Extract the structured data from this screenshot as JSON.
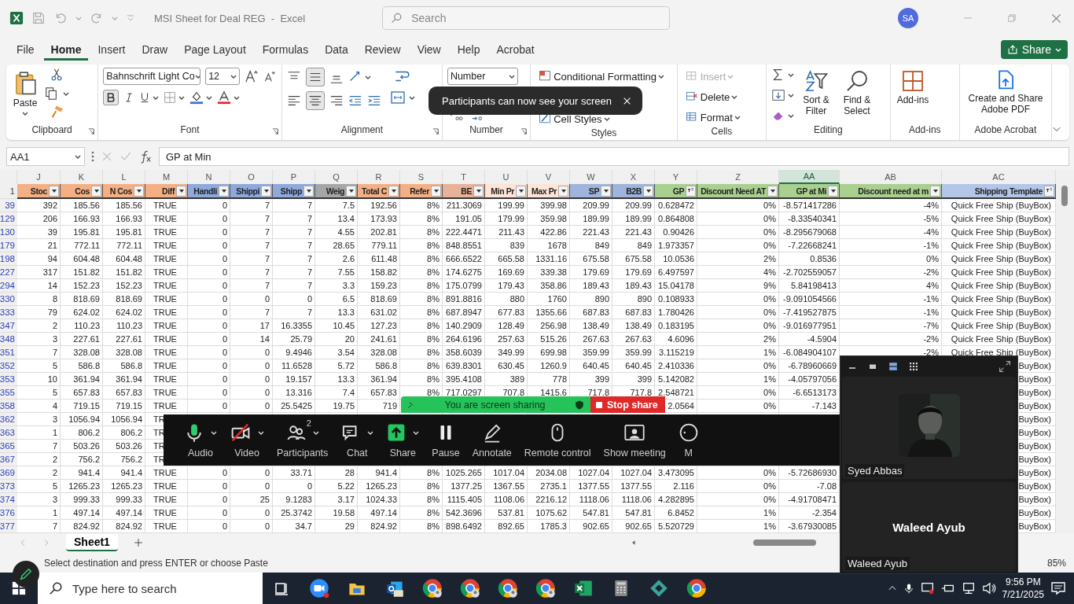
{
  "title_bar": {
    "title": "MSI Sheet for Deal REG  -  Excel",
    "search": {
      "placeholder": "Search"
    },
    "avatar": "SA"
  },
  "menu_tabs": [
    {
      "label": "File",
      "selected": false
    },
    {
      "label": "Home",
      "selected": true
    },
    {
      "label": "Insert",
      "selected": false
    },
    {
      "label": "Draw",
      "selected": false
    },
    {
      "label": "Page Layout",
      "selected": false
    },
    {
      "label": "Formulas",
      "selected": false
    },
    {
      "label": "Data",
      "selected": false
    },
    {
      "label": "Review",
      "selected": false
    },
    {
      "label": "View",
      "selected": false
    },
    {
      "label": "Help",
      "selected": false
    },
    {
      "label": "Acrobat",
      "selected": false
    }
  ],
  "share_button": "Share",
  "clipboard": {
    "label": "Clipboard",
    "paste": "Paste"
  },
  "font": {
    "label": "Font",
    "name": "Bahnschrift Light Co",
    "size": "12",
    "bold": true
  },
  "alignment": {
    "label": "Alignment",
    "middle_selected": true,
    "center_selected": true
  },
  "number": {
    "label": "Number",
    "format": "Number"
  },
  "styles": {
    "label": "Styles",
    "items": [
      "Conditional Formatting",
      "Cell Styles"
    ]
  },
  "cells": {
    "label": "Cells",
    "items": [
      {
        "kind": "insert",
        "label": "Insert",
        "disabled": true
      },
      {
        "kind": "delete",
        "label": "Delete",
        "disabled": false
      },
      {
        "kind": "format",
        "label": "Format",
        "disabled": false
      }
    ]
  },
  "editing": {
    "label": "Editing",
    "sort": "Sort & Filter",
    "find": "Find & Select"
  },
  "addins": {
    "label": "Add-ins",
    "button": "Add-ins"
  },
  "acrobat": {
    "label": "Adobe Acrobat",
    "button": "Create and Share Adobe PDF"
  },
  "toast": {
    "text": "Participants can now see your screen"
  },
  "formula_bar": {
    "name_box": "AA1",
    "formula": "GP at Min"
  },
  "sheet": {
    "header_row": "1",
    "columns": [
      {
        "letter": "J",
        "header": "Stoc",
        "color": "#f4b084",
        "kind": "number",
        "filtered": false,
        "selected": false
      },
      {
        "letter": "K",
        "header": "Cos",
        "color": "#f4b084",
        "kind": "number",
        "filtered": false,
        "selected": false
      },
      {
        "letter": "L",
        "header": "N Cos",
        "color": "#f4b084",
        "kind": "number",
        "filtered": false,
        "selected": false
      },
      {
        "letter": "M",
        "header": "Diff",
        "color": "#f4b084",
        "kind": "boolean",
        "filtered": false,
        "selected": false
      },
      {
        "letter": "N",
        "header": "Handli",
        "color": "#8ea9db",
        "kind": "number",
        "filtered": false,
        "selected": false
      },
      {
        "letter": "O",
        "header": "Shippi",
        "color": "#8ea9db",
        "kind": "number",
        "filtered": false,
        "selected": false
      },
      {
        "letter": "P",
        "header": "Shipp",
        "color": "#8ea9db",
        "kind": "number",
        "filtered": false,
        "selected": false
      },
      {
        "letter": "Q",
        "header": "Weig",
        "color": "#a6a6a6",
        "kind": "number",
        "filtered": false,
        "selected": false
      },
      {
        "letter": "R",
        "header": "Total C",
        "color": "#f4b084",
        "kind": "number",
        "filtered": false,
        "selected": false
      },
      {
        "letter": "S",
        "header": "Refer",
        "color": "#f4b084",
        "kind": "number",
        "filtered": false,
        "selected": false
      },
      {
        "letter": "T",
        "header": "BE",
        "color": "#e8b199",
        "kind": "number",
        "filtered": false,
        "selected": false
      },
      {
        "letter": "U",
        "header": "Min Pr",
        "color": "#fce4d6",
        "kind": "number",
        "filtered": false,
        "selected": false
      },
      {
        "letter": "V",
        "header": "Max Pr",
        "color": "#fce4d6",
        "kind": "number",
        "filtered": false,
        "selected": false
      },
      {
        "letter": "W",
        "header": "SP",
        "color": "#9fb4dc",
        "kind": "number",
        "filtered": false,
        "selected": false
      },
      {
        "letter": "X",
        "header": "B2B",
        "color": "#9fb4dc",
        "kind": "number",
        "filtered": false,
        "selected": false
      },
      {
        "letter": "Y",
        "header": "GP",
        "color": "#a9d08e",
        "kind": "number",
        "filtered": true,
        "selected": false
      },
      {
        "letter": "Z",
        "header": "Discount Need AT",
        "color": "#a9d08e",
        "kind": "number",
        "filtered": false,
        "selected": false
      },
      {
        "letter": "AA",
        "header": "GP at Mi",
        "color": "#a9d08e",
        "kind": "number",
        "filtered": false,
        "selected": true
      },
      {
        "letter": "AB",
        "header": "Discount need at m",
        "color": "#a9d08e",
        "kind": "number",
        "filtered": false,
        "selected": false
      },
      {
        "letter": "AC",
        "header": "Shipping Template",
        "color": "#b4c6e7",
        "kind": "text",
        "filtered": true,
        "selected": false
      }
    ],
    "rows": [
      {
        "number": "39",
        "cells": [
          "392",
          "185.56",
          "185.56",
          "TRUE",
          "0",
          "7",
          "7",
          "7.5",
          "192.56",
          "8%",
          "211.3069",
          "199.99",
          "399.98",
          "209.99",
          "209.99",
          "0.628472",
          "0%",
          "-8.571417286",
          "-4%",
          "Quick Free Ship (BuyBox)"
        ]
      },
      {
        "number": "129",
        "cells": [
          "206",
          "166.93",
          "166.93",
          "TRUE",
          "0",
          "7",
          "7",
          "13.4",
          "173.93",
          "8%",
          "191.05",
          "179.99",
          "359.98",
          "189.99",
          "189.99",
          "0.864808",
          "0%",
          "-8.33540341",
          "-5%",
          "Quick Free Ship (BuyBox)"
        ]
      },
      {
        "number": "130",
        "cells": [
          "39",
          "195.81",
          "195.81",
          "TRUE",
          "0",
          "7",
          "7",
          "4.55",
          "202.81",
          "8%",
          "222.4471",
          "211.43",
          "422.86",
          "221.43",
          "221.43",
          "0.90426",
          "0%",
          "-8.295679068",
          "-4%",
          "Quick Free Ship (BuyBox)"
        ]
      },
      {
        "number": "179",
        "cells": [
          "21",
          "772.11",
          "772.11",
          "TRUE",
          "0",
          "7",
          "7",
          "28.65",
          "779.11",
          "8%",
          "848.8551",
          "839",
          "1678",
          "849",
          "849",
          "1.973357",
          "0%",
          "-7.22668241",
          "-1%",
          "Quick Free Ship (BuyBox)"
        ]
      },
      {
        "number": "198",
        "cells": [
          "94",
          "604.48",
          "604.48",
          "TRUE",
          "0",
          "7",
          "7",
          "2.6",
          "611.48",
          "8%",
          "666.6522",
          "665.58",
          "1331.16",
          "675.58",
          "675.58",
          "10.0536",
          "2%",
          "0.8536",
          "0%",
          "Quick Free Ship (BuyBox)"
        ]
      },
      {
        "number": "227",
        "cells": [
          "317",
          "151.82",
          "151.82",
          "TRUE",
          "0",
          "7",
          "7",
          "7.55",
          "158.82",
          "8%",
          "174.6275",
          "169.69",
          "339.38",
          "179.69",
          "179.69",
          "6.497597",
          "4%",
          "-2.702559057",
          "-2%",
          "Quick Free Ship (BuyBox)"
        ]
      },
      {
        "number": "294",
        "cells": [
          "14",
          "152.23",
          "152.23",
          "TRUE",
          "0",
          "7",
          "7",
          "3.3",
          "159.23",
          "8%",
          "175.0799",
          "179.43",
          "358.86",
          "189.43",
          "189.43",
          "15.04178",
          "9%",
          "5.84198413",
          "4%",
          "Quick Free Ship (BuyBox)"
        ]
      },
      {
        "number": "330",
        "cells": [
          "8",
          "818.69",
          "818.69",
          "TRUE",
          "0",
          "0",
          "0",
          "6.5",
          "818.69",
          "8%",
          "891.8816",
          "880",
          "1760",
          "890",
          "890",
          "0.108933",
          "0%",
          "-9.091054566",
          "-1%",
          "Quick Free Ship (BuyBox)"
        ]
      },
      {
        "number": "333",
        "cells": [
          "79",
          "624.02",
          "624.02",
          "TRUE",
          "0",
          "7",
          "7",
          "13.3",
          "631.02",
          "8%",
          "687.8947",
          "677.83",
          "1355.66",
          "687.83",
          "687.83",
          "1.780426",
          "0%",
          "-7.419527875",
          "-1%",
          "Quick Free Ship (BuyBox)"
        ]
      },
      {
        "number": "347",
        "cells": [
          "2",
          "110.23",
          "110.23",
          "TRUE",
          "0",
          "17",
          "16.3355",
          "10.45",
          "127.23",
          "8%",
          "140.2909",
          "128.49",
          "256.98",
          "138.49",
          "138.49",
          "0.183195",
          "0%",
          "-9.016977951",
          "-7%",
          "Quick Free Ship (BuyBox)"
        ]
      },
      {
        "number": "348",
        "cells": [
          "3",
          "227.61",
          "227.61",
          "TRUE",
          "0",
          "14",
          "25.79",
          "20",
          "241.61",
          "8%",
          "264.6196",
          "257.63",
          "515.26",
          "267.63",
          "267.63",
          "4.6096",
          "2%",
          "-4.5904",
          "-2%",
          "Quick Free Ship (BuyBox)"
        ]
      },
      {
        "number": "351",
        "cells": [
          "7",
          "328.08",
          "328.08",
          "TRUE",
          "0",
          "0",
          "9.4946",
          "3.54",
          "328.08",
          "8%",
          "358.6039",
          "349.99",
          "699.98",
          "359.99",
          "359.99",
          "3.115219",
          "1%",
          "-6.084904107",
          "-2%",
          "Quick Free Ship (BuyBox)"
        ]
      },
      {
        "number": "352",
        "cells": [
          "5",
          "586.8",
          "586.8",
          "TRUE",
          "0",
          "0",
          "11.6528",
          "5.72",
          "586.8",
          "8%",
          "639.8301",
          "630.45",
          "1260.9",
          "640.45",
          "640.45",
          "2.410336",
          "0%",
          "-6.78960669",
          null,
          "BuyBox)"
        ]
      },
      {
        "number": "353",
        "cells": [
          "10",
          "361.94",
          "361.94",
          "TRUE",
          "0",
          "0",
          "19.157",
          "13.3",
          "361.94",
          "8%",
          "395.4108",
          "389",
          "778",
          "399",
          "399",
          "5.142082",
          "1%",
          "-4.05797056",
          null,
          "BuyBox)"
        ]
      },
      {
        "number": "355",
        "cells": [
          "5",
          "657.83",
          "657.83",
          "TRUE",
          "0",
          "0",
          "13.316",
          "7.4",
          "657.83",
          "8%",
          "717.0297",
          "707.8",
          "1415.6",
          "717.8",
          "717.8",
          "2.548721",
          "0%",
          "-6.6513173",
          null,
          "BuyBox)"
        ]
      },
      {
        "number": "358",
        "cells": [
          "4",
          "719.15",
          "719.15",
          "TRUE",
          "0",
          "0",
          "25.5425",
          "19.75",
          "719",
          null,
          null,
          null,
          null,
          null,
          null,
          "2.0564",
          "0%",
          "-7.143",
          null,
          "BuyBox)"
        ]
      },
      {
        "number": "362",
        "cells": [
          "3",
          "1056.94",
          "1056.94",
          "TR",
          null,
          null,
          null,
          null,
          null,
          null,
          null,
          null,
          null,
          null,
          null,
          null,
          null,
          null,
          null,
          "BuyBox)"
        ]
      },
      {
        "number": "363",
        "cells": [
          "1",
          "806.2",
          "806.2",
          "TR",
          null,
          null,
          null,
          null,
          null,
          null,
          null,
          null,
          null,
          null,
          null,
          null,
          null,
          null,
          null,
          "BuyBox)"
        ]
      },
      {
        "number": "365",
        "cells": [
          "7",
          "503.26",
          "503.26",
          "TR",
          null,
          null,
          null,
          null,
          null,
          null,
          null,
          null,
          null,
          null,
          null,
          null,
          null,
          null,
          null,
          "BuyBox)"
        ]
      },
      {
        "number": "367",
        "cells": [
          "2",
          "756.2",
          "756.2",
          "TR",
          null,
          null,
          null,
          null,
          null,
          null,
          null,
          null,
          null,
          null,
          null,
          null,
          null,
          null,
          null,
          "BuyBox)"
        ]
      },
      {
        "number": "369",
        "cells": [
          "2",
          "941.4",
          "941.4",
          "TRUE",
          "0",
          "0",
          "33.71",
          "28",
          "941.4",
          "8%",
          "1025.265",
          "1017.04",
          "2034.08",
          "1027.04",
          "1027.04",
          "3.473095",
          "0%",
          "-5.72686930",
          null,
          "BuyBox)"
        ]
      },
      {
        "number": "373",
        "cells": [
          "5",
          "1265.23",
          "1265.23",
          "TRUE",
          "0",
          "0",
          "0",
          "5.22",
          "1265.23",
          "8%",
          "1377.25",
          "1367.55",
          "2735.1",
          "1377.55",
          "1377.55",
          "2.116",
          "0%",
          "-7.08",
          null,
          "BuyBox)"
        ]
      },
      {
        "number": "374",
        "cells": [
          "3",
          "999.33",
          "999.33",
          "TRUE",
          "0",
          "25",
          "9.1283",
          "3.17",
          "1024.33",
          "8%",
          "1115.405",
          "1108.06",
          "2216.12",
          "1118.06",
          "1118.06",
          "4.282895",
          "0%",
          "-4.91708471",
          null,
          "BuyBox)"
        ]
      },
      {
        "number": "376",
        "cells": [
          "1",
          "497.14",
          "497.14",
          "TRUE",
          "0",
          "0",
          "25.3742",
          "19.58",
          "497.14",
          "8%",
          "542.3696",
          "537.81",
          "1075.62",
          "547.81",
          "547.81",
          "6.8452",
          "1%",
          "-2.354",
          null,
          "BuyBox)"
        ]
      },
      {
        "number": "377",
        "cells": [
          "7",
          "824.92",
          "824.92",
          "TRUE",
          "0",
          "0",
          "34.7",
          "29",
          "824.92",
          "8%",
          "898.6492",
          "892.65",
          "1785.3",
          "902.65",
          "902.65",
          "5.520729",
          "1%",
          "-3.67930085",
          null,
          "BuyBox)"
        ]
      }
    ]
  },
  "sheet_tabs": [
    {
      "label": "Sheet1",
      "selected": true
    }
  ],
  "status_bar": {
    "message": "Select destination and press ENTER or choose Paste",
    "zoom": "85%"
  },
  "share_banner": {
    "text": "You are screen sharing",
    "stop": "Stop share"
  },
  "meeting_toolbar": [
    {
      "kind": "audio",
      "label": "Audio",
      "has_menu": true
    },
    {
      "kind": "video",
      "label": "Video",
      "has_menu": true
    },
    {
      "kind": "participants",
      "label": "Participants",
      "has_menu": true,
      "badge": "2"
    },
    {
      "kind": "chat",
      "label": "Chat",
      "has_menu": true
    },
    {
      "kind": "share",
      "label": "Share",
      "has_menu": true
    },
    {
      "kind": "pause",
      "label": "Pause",
      "has_menu": false
    },
    {
      "kind": "annotate",
      "label": "Annotate",
      "has_menu": false
    },
    {
      "kind": "remote",
      "label": "Remote control",
      "has_menu": false
    },
    {
      "kind": "show_meeting",
      "label": "Show meeting",
      "has_menu": false
    },
    {
      "kind": "more",
      "label": "M",
      "has_menu": false
    }
  ],
  "video_panel": {
    "tiles": [
      {
        "kind": "picture",
        "name": "Syed Abbas"
      },
      {
        "kind": "name",
        "title": "Waleed Ayub",
        "name": "Waleed Ayub"
      }
    ]
  },
  "taskbar": {
    "search": {
      "placeholder": "Type here to search"
    },
    "time": "9:56 PM",
    "date": "7/21/2025"
  }
}
